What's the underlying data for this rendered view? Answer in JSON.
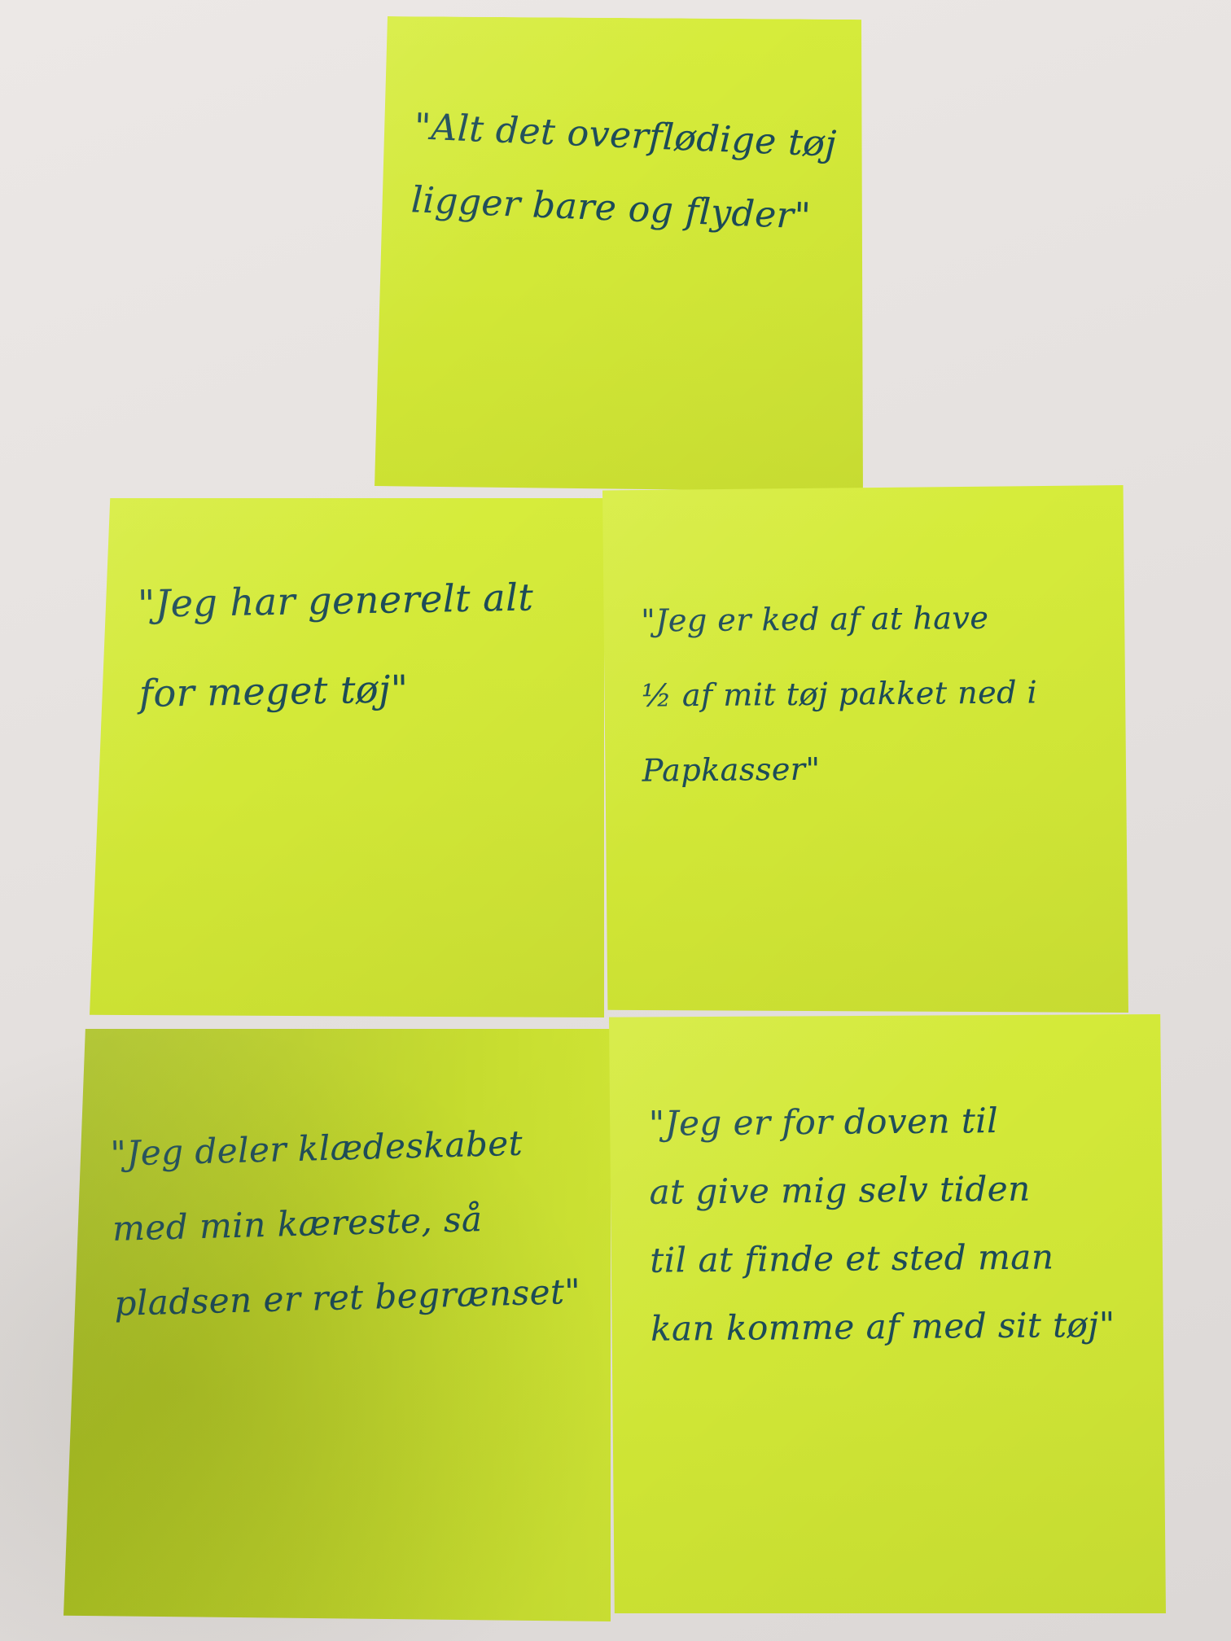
{
  "notes": [
    {
      "text": "\"Alt det overflødige tøj\nligger bare og flyder\""
    },
    {
      "text": "\"Jeg har generelt alt\nfor meget tøj\""
    },
    {
      "text": "\"Jeg er ked af at have\n½ af mit tøj pakket ned i\nPapkasser\""
    },
    {
      "text": "\"Jeg deler klædeskabet\nmed min kæreste, så\npladsen er ret begrænset\""
    },
    {
      "text": "\"Jeg er for doven til\nat give mig selv tiden\ntil at finde et sted man\nkan komme af med sit tøj\""
    }
  ],
  "colors": {
    "note": "#d4ea39",
    "ink": "#1c4b58",
    "table": "#e8e4e2"
  }
}
